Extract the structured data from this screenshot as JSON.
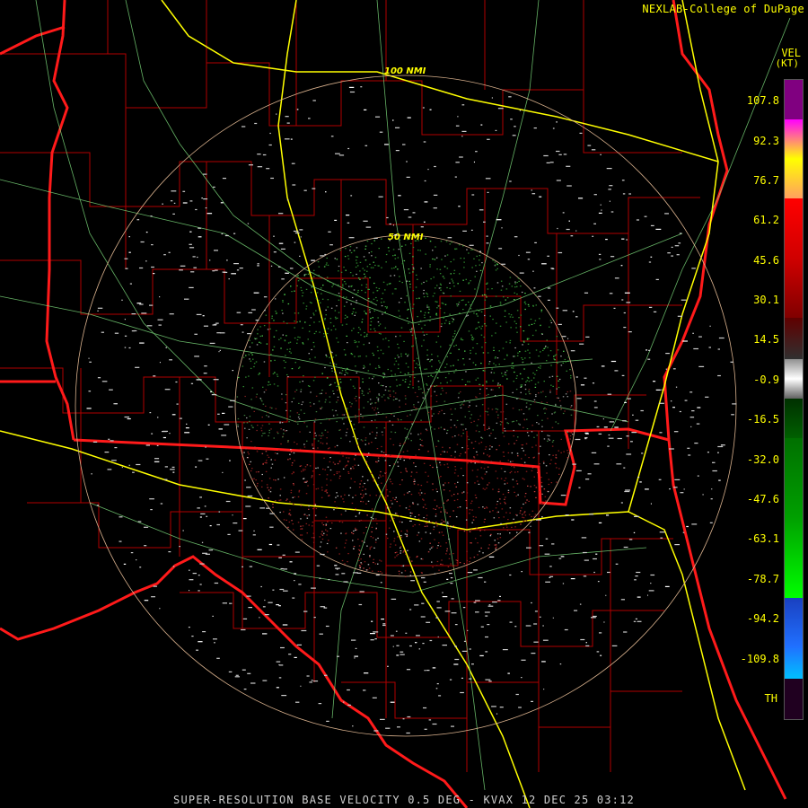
{
  "credit": "NEXLAB-College of DuPage",
  "product": "VEL",
  "units": "(KT)",
  "footer": "SUPER-RESOLUTION BASE VELOCITY 0.5 DEG - KVAX 12 DEC 25 03:12",
  "range_rings": [
    {
      "label": "50 NMI"
    },
    {
      "label": "100 NMI"
    }
  ],
  "colorbar_labels": [
    "107.8",
    "92.3",
    "76.7",
    "61.2",
    "45.6",
    "30.1",
    "14.5",
    "-0.9",
    "-16.5",
    "-32.0",
    "-47.6",
    "-63.1",
    "-78.7",
    "-94.2",
    "-109.8",
    "TH"
  ],
  "colors": {
    "state_lines": "#ff0000",
    "county_lines": "#c00000",
    "highways": "#ffff00",
    "roads": "#88ee88",
    "range_rings": "#d8b08c",
    "text": "#ffff00"
  }
}
